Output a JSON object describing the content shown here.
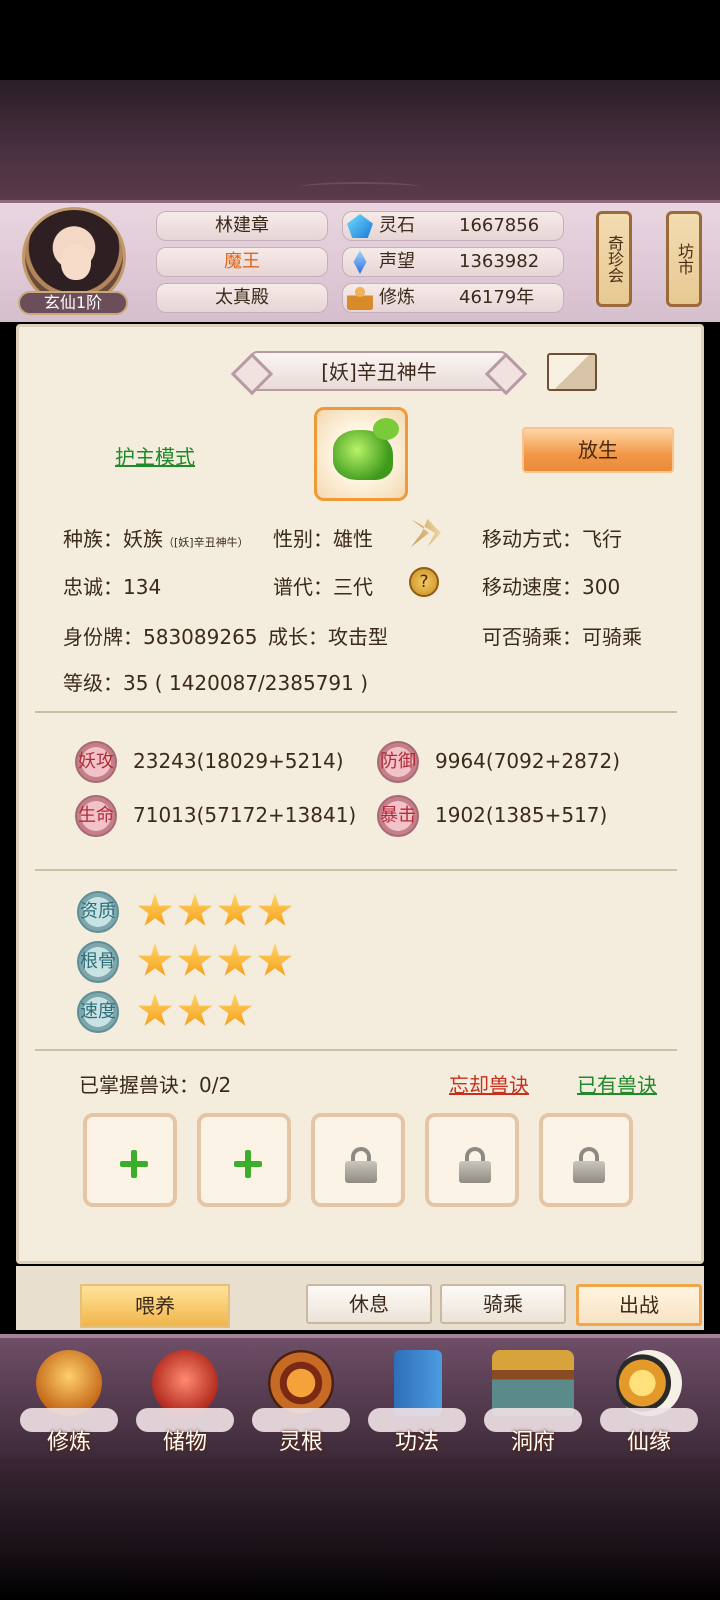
{
  "header": {
    "player_name": "林建章",
    "title": "魔王",
    "sect": "太真殿",
    "rank": "玄仙1阶",
    "resources": [
      {
        "label": "灵石",
        "value": "1667856",
        "icon": "spirit-stone-icon"
      },
      {
        "label": "声望",
        "value": "1363982",
        "icon": "fame-icon"
      },
      {
        "label": "修炼",
        "value": "46179年",
        "icon": "meditation-icon"
      }
    ],
    "scrolls": [
      {
        "label": "奇珍会"
      },
      {
        "label": "坊市"
      }
    ]
  },
  "pet": {
    "name": "[妖]辛丑神牛",
    "guard_mode": "护主模式",
    "release_label": "放生",
    "info": {
      "race_label": "种族：",
      "race": "妖族",
      "race_note": "[妖]辛丑神牛",
      "gender_label": "性别：",
      "gender": "雄性",
      "move_type_label": "移动方式：",
      "move_type": "飞行",
      "loyalty_label": "忠诚：",
      "loyalty": "134",
      "generation_label": "谱代：",
      "generation": "三代",
      "move_speed_label": "移动速度：",
      "move_speed": "300",
      "id_label": "身份牌：",
      "id": "583089265",
      "growth_label": "成长：",
      "growth": "攻击型",
      "rideable_label": "可否骑乘：",
      "rideable": "可骑乘",
      "level_label": "等级：",
      "level": "35",
      "exp": "1420087/2385791"
    },
    "attributes": [
      {
        "label": "妖攻",
        "value": "23243(18029+5214)"
      },
      {
        "label": "防御",
        "value": "9964(7092+2872)"
      },
      {
        "label": "生命",
        "value": "71013(57172+13841)"
      },
      {
        "label": "暴击",
        "value": "1902(1385+517)"
      }
    ],
    "aptitudes": [
      {
        "label": "资质",
        "stars": 4
      },
      {
        "label": "根骨",
        "stars": 4
      },
      {
        "label": "速度",
        "stars": 3
      }
    ],
    "skills": {
      "mastered_label": "已掌握兽诀：",
      "mastered": "0/2",
      "forget_label": "忘却兽诀",
      "owned_label": "已有兽诀",
      "slots": [
        "add",
        "add",
        "locked",
        "locked",
        "locked"
      ]
    }
  },
  "actions": {
    "feed": "喂养",
    "rest": "休息",
    "ride": "骑乘",
    "fight": "出战"
  },
  "nav": [
    {
      "label": "修炼"
    },
    {
      "label": "储物"
    },
    {
      "label": "灵根"
    },
    {
      "label": "功法"
    },
    {
      "label": "洞府"
    },
    {
      "label": "仙缘"
    }
  ]
}
